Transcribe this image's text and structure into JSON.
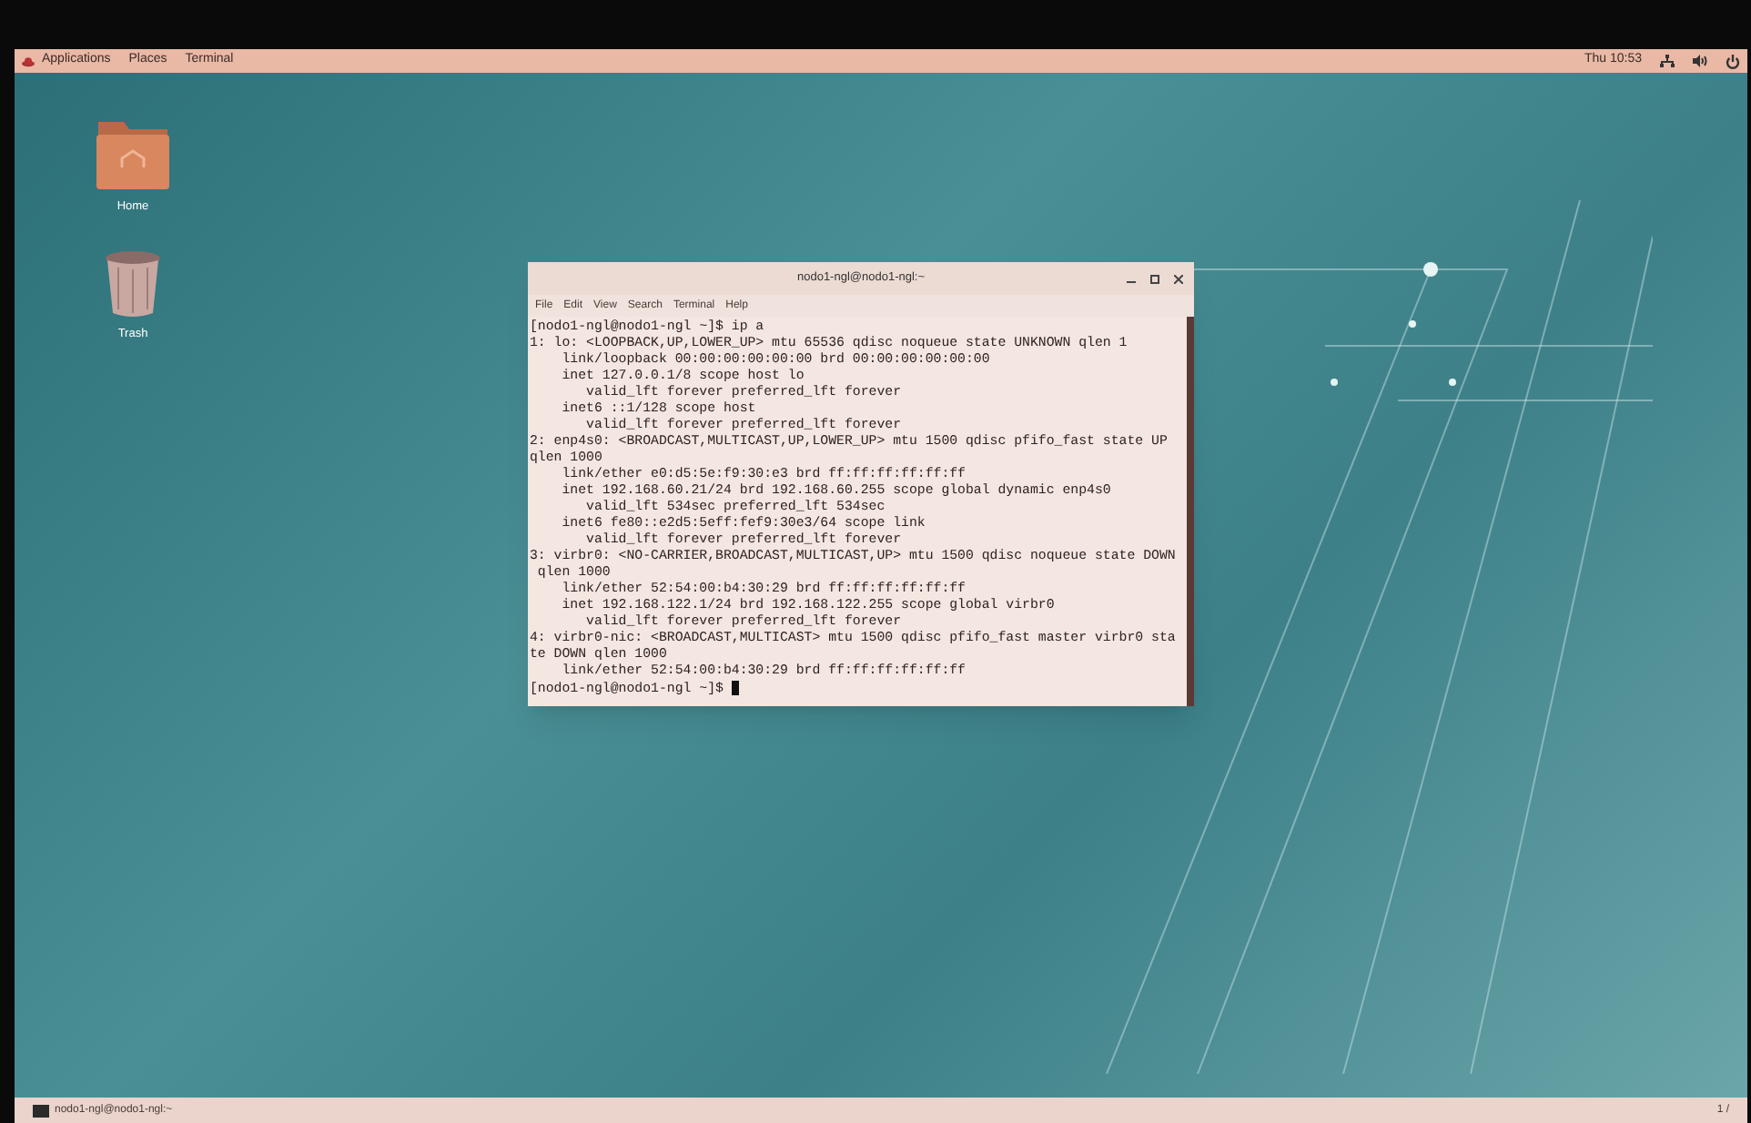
{
  "top_panel": {
    "menus": [
      "Applications",
      "Places",
      "Terminal"
    ],
    "clock": "Thu 10:53"
  },
  "desktop_icons": [
    {
      "kind": "folder",
      "label": "Home"
    },
    {
      "kind": "trash",
      "label": "Trash"
    }
  ],
  "terminal": {
    "title": "nodo1-ngl@nodo1-ngl:~",
    "menu": [
      "File",
      "Edit",
      "View",
      "Search",
      "Terminal",
      "Help"
    ],
    "lines": [
      "[nodo1-ngl@nodo1-ngl ~]$ ip a",
      "1: lo: <LOOPBACK,UP,LOWER_UP> mtu 65536 qdisc noqueue state UNKNOWN qlen 1",
      "    link/loopback 00:00:00:00:00:00 brd 00:00:00:00:00:00",
      "    inet 127.0.0.1/8 scope host lo",
      "       valid_lft forever preferred_lft forever",
      "    inet6 ::1/128 scope host",
      "       valid_lft forever preferred_lft forever",
      "2: enp4s0: <BROADCAST,MULTICAST,UP,LOWER_UP> mtu 1500 qdisc pfifo_fast state UP",
      "qlen 1000",
      "    link/ether e0:d5:5e:f9:30:e3 brd ff:ff:ff:ff:ff:ff",
      "    inet 192.168.60.21/24 brd 192.168.60.255 scope global dynamic enp4s0",
      "       valid_lft 534sec preferred_lft 534sec",
      "    inet6 fe80::e2d5:5eff:fef9:30e3/64 scope link",
      "       valid_lft forever preferred_lft forever",
      "3: virbr0: <NO-CARRIER,BROADCAST,MULTICAST,UP> mtu 1500 qdisc noqueue state DOWN",
      " qlen 1000",
      "    link/ether 52:54:00:b4:30:29 brd ff:ff:ff:ff:ff:ff",
      "    inet 192.168.122.1/24 brd 192.168.122.255 scope global virbr0",
      "       valid_lft forever preferred_lft forever",
      "4: virbr0-nic: <BROADCAST,MULTICAST> mtu 1500 qdisc pfifo_fast master virbr0 sta",
      "te DOWN qlen 1000",
      "    link/ether 52:54:00:b4:30:29 brd ff:ff:ff:ff:ff:ff",
      "[nodo1-ngl@nodo1-ngl ~]$ "
    ]
  },
  "bottom_panel": {
    "window_button": "nodo1-ngl@nodo1-ngl:~",
    "workspace": "1 /"
  }
}
